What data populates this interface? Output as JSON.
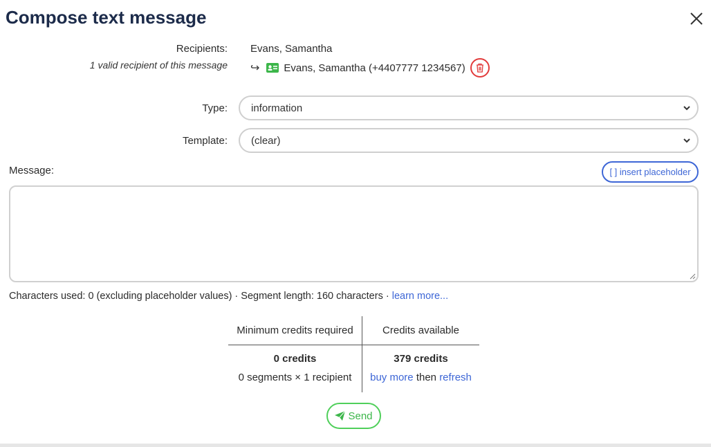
{
  "dialog": {
    "title": "Compose text message"
  },
  "recipients": {
    "label": "Recipients:",
    "name": "Evans, Samantha",
    "valid_note": "1 valid recipient of this message",
    "contact_entry": "Evans, Samantha (+4407777 1234567)"
  },
  "type_field": {
    "label": "Type:",
    "value": "information"
  },
  "template_field": {
    "label": "Template:",
    "value": "(clear)"
  },
  "message": {
    "label": "Message:",
    "insert_placeholder_label": "[ ] insert placeholder",
    "value": ""
  },
  "info_line": {
    "text": "Characters used: 0 (excluding placeholder values) · Segment length: 160 characters · ",
    "learn_more": "learn more..."
  },
  "credits": {
    "col1_header": "Minimum credits required",
    "col2_header": "Credits available",
    "required": "0 credits",
    "required_detail": "0 segments × 1 recipient",
    "available": "379 credits",
    "buy_more": "buy more",
    "then": "then",
    "refresh": "refresh"
  },
  "send": {
    "label": "Send"
  },
  "colors": {
    "title": "#1c2b4a",
    "link": "#3d66d6",
    "danger": "#e23b3b",
    "success": "#4fcf5a"
  },
  "icons": {
    "close": "close-icon",
    "arrow": "return-arrow-icon",
    "contact": "contact-card-icon",
    "trash": "trash-icon",
    "send": "paper-plane-icon",
    "dropdown": "chevron-down-icon"
  }
}
